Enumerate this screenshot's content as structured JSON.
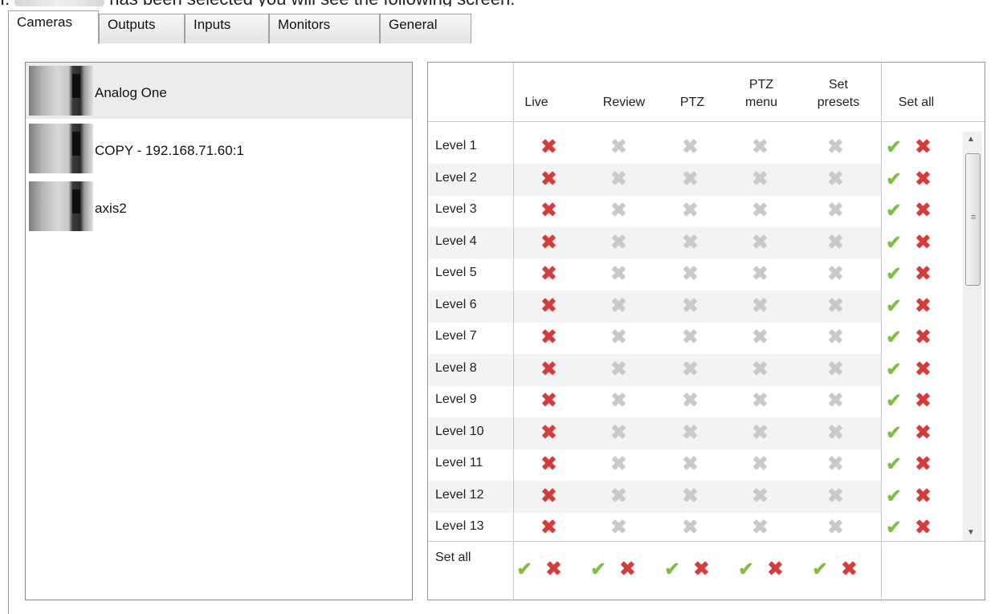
{
  "doc_text_visible": "has been selected you will see the following screen.",
  "tabs": [
    {
      "label": "Cameras",
      "active": true
    },
    {
      "label": "Outputs",
      "active": false
    },
    {
      "label": "Inputs",
      "active": false
    },
    {
      "label": "Monitors",
      "active": false
    },
    {
      "label": "General",
      "active": false
    }
  ],
  "cameras": [
    {
      "name": "Analog One",
      "selected": true
    },
    {
      "name": "COPY - 192.168.71.60:1",
      "selected": false
    },
    {
      "name": "axis2",
      "selected": false
    }
  ],
  "grid": {
    "columns": [
      {
        "line1": "",
        "line2": "Live"
      },
      {
        "line1": "",
        "line2": "Review"
      },
      {
        "line1": "",
        "line2": "PTZ"
      },
      {
        "line1": "PTZ",
        "line2": "menu"
      },
      {
        "line1": "Set",
        "line2": "presets"
      },
      {
        "line1": "",
        "line2": "Set all"
      }
    ],
    "levels": [
      "Level 1",
      "Level 2",
      "Level 3",
      "Level 4",
      "Level 5",
      "Level 6",
      "Level 7",
      "Level 8",
      "Level 9",
      "Level 10",
      "Level 11",
      "Level 12",
      "Level 13"
    ],
    "row_values": {
      "Live": "denied",
      "Review": "unset",
      "PTZ": "unset",
      "PTZ menu": "unset",
      "Set presets": "unset"
    },
    "footer_label": "Set all",
    "colors": {
      "denied": "#d63a3a",
      "unset": "#c9c9c9",
      "allow": "#7cc13c"
    }
  },
  "icons": {
    "deny": "red-x-icon",
    "unset": "gray-x-icon",
    "allow": "green-check-icon"
  }
}
